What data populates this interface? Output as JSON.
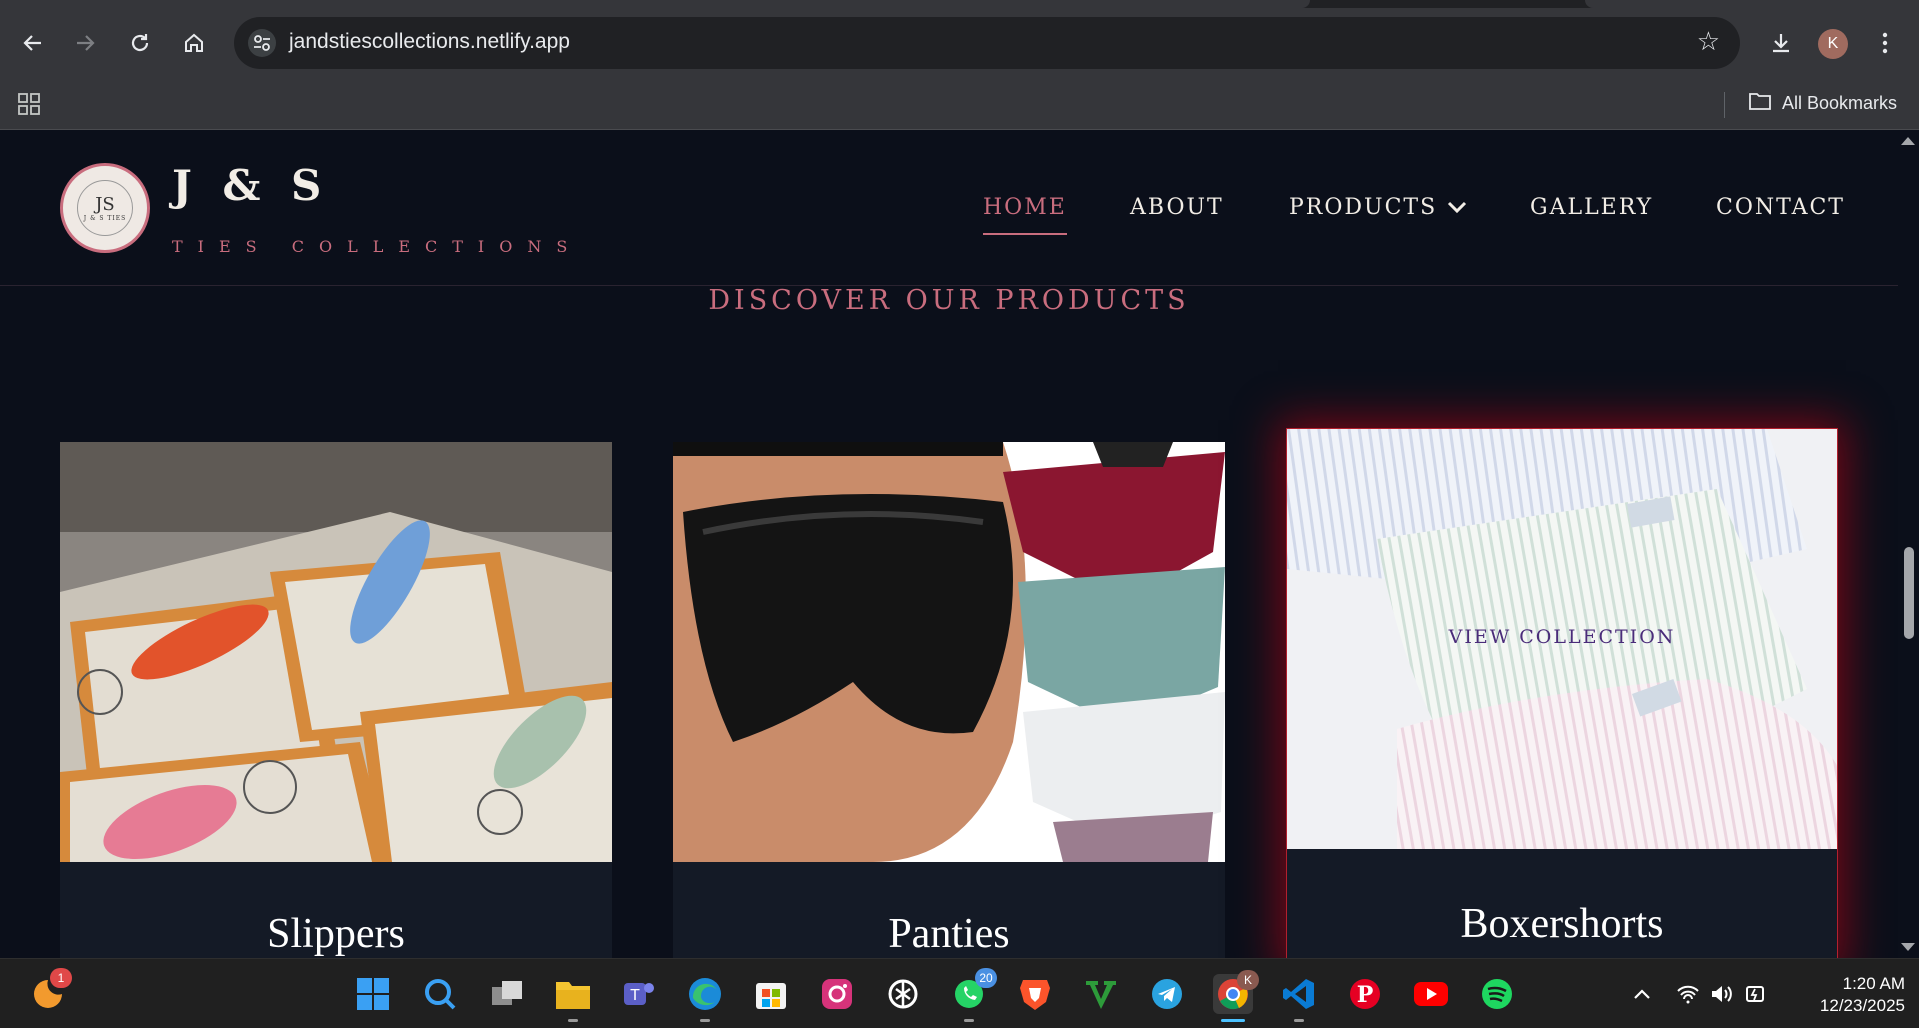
{
  "browser": {
    "url": "jandstiescollections.netlify.app",
    "profile_initial": "K",
    "all_bookmarks_label": "All Bookmarks",
    "icons": [
      "back-arrow-icon",
      "forward-arrow-icon",
      "reload-icon",
      "home-icon",
      "site-settings-icon",
      "star-icon",
      "download-icon",
      "more-menu-icon",
      "apps-grid-icon",
      "folder-icon"
    ]
  },
  "site": {
    "brand_title": "J & S",
    "brand_subtitle": "TIES COLLECTIONS",
    "logo_text_main": "JS",
    "logo_text_small": "J & S TIES",
    "nav": [
      {
        "label": "HOME",
        "active": true
      },
      {
        "label": "ABOUT",
        "active": false
      },
      {
        "label": "PRODUCTS",
        "active": false,
        "has_dropdown": true
      },
      {
        "label": "GALLERY",
        "active": false
      },
      {
        "label": "CONTACT",
        "active": false
      }
    ],
    "section_title": "DISCOVER OUR PRODUCTS",
    "products": [
      {
        "name": "Slippers"
      },
      {
        "name": "Panties"
      },
      {
        "name": "Boxershorts",
        "hover_label": "VIEW COLLECTION"
      }
    ],
    "colors": {
      "accent": "#c96d7e",
      "background": "#0b0f1a",
      "hover_glow": "#c80014"
    }
  },
  "taskbar": {
    "apps": [
      "app-launcher",
      "start",
      "search",
      "task-view",
      "file-explorer",
      "teams",
      "edge",
      "microsoft-store",
      "instagram",
      "chatgpt",
      "whatsapp",
      "brave",
      "vim",
      "telegram",
      "chrome",
      "vscode",
      "pinterest",
      "youtube",
      "spotify"
    ],
    "launcher_badge": "1",
    "whatsapp_badge": "20",
    "chrome_badge": "K",
    "time": "1:20 AM",
    "date": "12/23/2025"
  }
}
